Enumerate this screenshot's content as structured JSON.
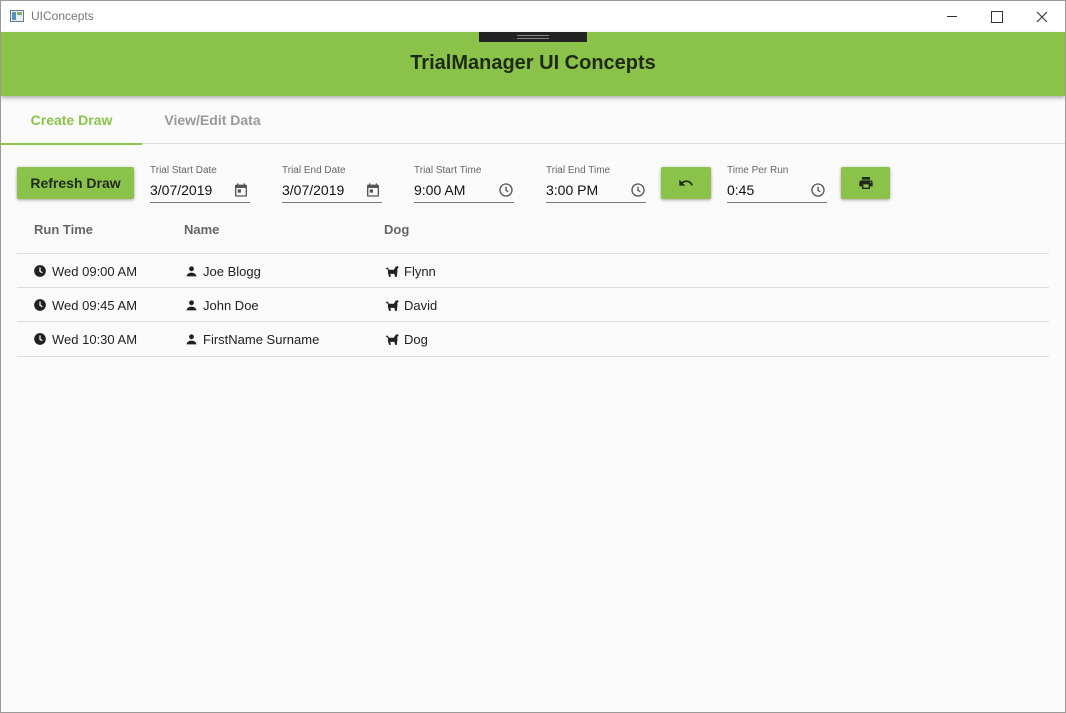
{
  "window": {
    "title": "UIConcepts"
  },
  "header": {
    "title": "TrialManager UI Concepts"
  },
  "tabs": [
    {
      "label": "Create Draw",
      "active": true
    },
    {
      "label": "View/Edit Data",
      "active": false
    }
  ],
  "toolbar": {
    "refresh_label": "Refresh Draw",
    "undo_icon": "undo-icon",
    "print_icon": "print-icon",
    "trial_start_date": {
      "label": "Trial Start Date",
      "value": "3/07/2019",
      "icon": "calendar-icon"
    },
    "trial_end_date": {
      "label": "Trial End Date",
      "value": "3/07/2019",
      "icon": "calendar-icon"
    },
    "trial_start_time": {
      "label": "Trial Start Time",
      "value": "9:00 AM",
      "icon": "clock-icon"
    },
    "trial_end_time": {
      "label": "Trial End Time",
      "value": "3:00 PM",
      "icon": "clock-icon"
    },
    "time_per_run": {
      "label": "Time Per Run",
      "value": "0:45",
      "icon": "clock-icon"
    }
  },
  "table": {
    "columns": [
      "Run Time",
      "Name",
      "Dog"
    ],
    "rows": [
      {
        "time": "Wed 09:00 AM",
        "name": "Joe Blogg",
        "dog": "Flynn"
      },
      {
        "time": "Wed 09:45 AM",
        "name": "John Doe",
        "dog": "David"
      },
      {
        "time": "Wed 10:30 AM",
        "name": "FirstName Surname",
        "dog": "Dog"
      }
    ]
  },
  "colors": {
    "accent": "#8bc34a",
    "header_text": "#1e2a15"
  }
}
